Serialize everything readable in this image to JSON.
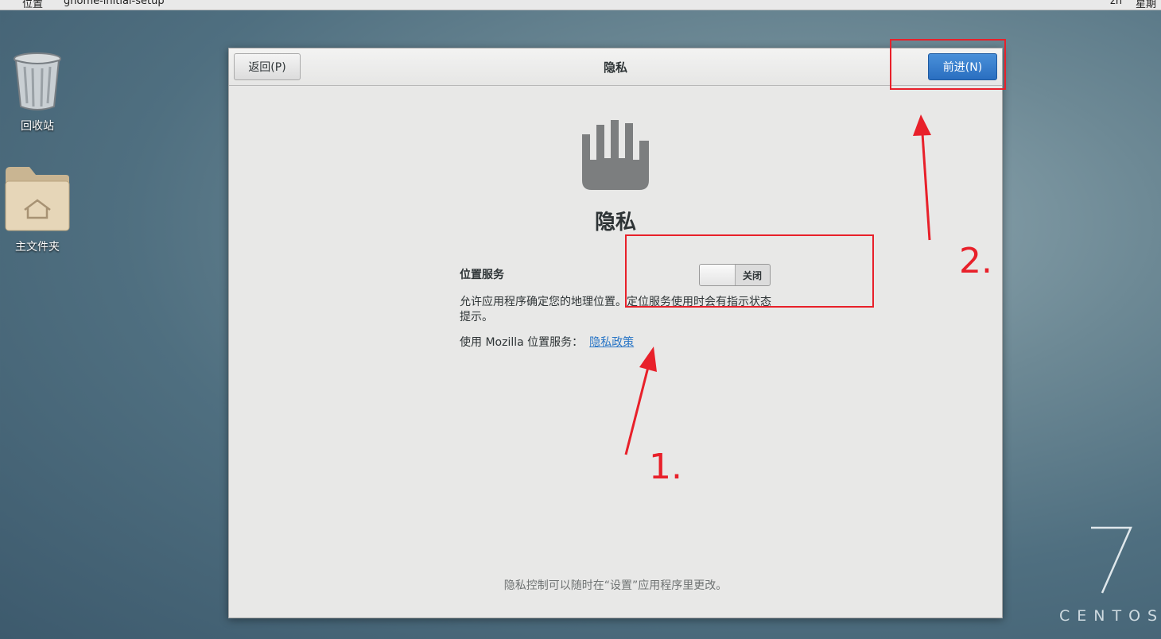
{
  "topbar": {
    "left_items": [
      "位置",
      "gnome-initial-setup"
    ],
    "right_items": [
      "zh",
      "星期"
    ]
  },
  "desktop": {
    "icons": [
      {
        "label": "回收站",
        "icon": "trash-icon"
      },
      {
        "label": "主文件夹",
        "icon": "home-folder-icon"
      }
    ],
    "branding": {
      "version": "7",
      "name": "CENTOS"
    }
  },
  "dialog": {
    "header": {
      "back_label": "返回(P)",
      "title": "隐私",
      "next_label": "前进(N)"
    },
    "page_icon": "hand-stop-icon",
    "page_title": "隐私",
    "location": {
      "label": "位置服务",
      "toggle_state": "关闭",
      "description": "允许应用程序确定您的地理位置。定位服务使用时会有指示状态提示。",
      "mozilla_text": "使用  Mozilla 位置服务：",
      "policy_link": "隐私政策"
    },
    "footer": "隐私控制可以随时在“设置”应用程序里更改。"
  },
  "annotations": {
    "color": "#e8202a",
    "labels": [
      "1.",
      "2."
    ]
  }
}
